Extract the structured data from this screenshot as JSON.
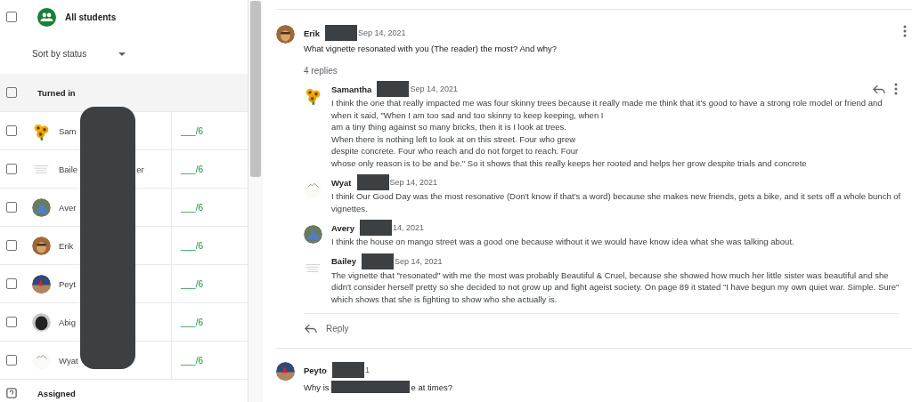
{
  "students_panel": {
    "select_all_checked": false,
    "title": "All students",
    "sort": {
      "label": "Sort by status"
    },
    "group": {
      "label": "Turned in",
      "checked": false
    },
    "students": [
      {
        "name_parts": [
          "Sam"
        ],
        "grade": "___/6",
        "checked": false,
        "kind": "sunflower"
      },
      {
        "name_parts": [
          "Baile",
          "er"
        ],
        "grade": "___/6",
        "checked": false,
        "kind": "note"
      },
      {
        "name_parts": [
          "Aver"
        ],
        "grade": "___/6",
        "checked": false,
        "kind": "blue"
      },
      {
        "name_parts": [
          "Erik"
        ],
        "grade": "___/6",
        "checked": false,
        "kind": "monkey"
      },
      {
        "name_parts": [
          "Peyt"
        ],
        "grade": "___/6",
        "checked": false,
        "kind": "cone"
      },
      {
        "name_parts": [
          "Abig"
        ],
        "grade": "___/6",
        "checked": false,
        "kind": "dog"
      },
      {
        "name_parts": [
          "Wyat"
        ],
        "grade": "___/6",
        "checked": false,
        "kind": "sketch"
      }
    ],
    "next_group": {
      "label": "Assigned"
    }
  },
  "threads": [
    {
      "author": "Erik",
      "date": "Sep 14, 2021",
      "kind": "monkey",
      "body_parts": [
        "What vignette resonated with you (The reader) the most? And why?"
      ],
      "replies_count": "4 replies",
      "replies": [
        {
          "author": "Samantha",
          "date": "Sep 14, 2021",
          "kind": "sunflower",
          "actions": true,
          "lines": [
            "I think the one that really impacted me was four skinny trees because it really made me think that it's good to have a strong role model or friend and when it said, \"When I am too sad and too skinny to keep keeping, when I",
            "am a tiny thing against so many bricks, then it is I look at trees.",
            "When there is nothing left to look at on this street. Four who grew",
            "despite concrete. Four who reach and do not forget to reach. Four",
            "whose only reason is to be and be.\" So it shows that this really keeps her rooted and helps her grow despite trials and concrete"
          ]
        },
        {
          "author": "Wyat",
          "date": "Sep 14, 2021",
          "kind": "sketch",
          "actions": false,
          "lines": [
            "I think Our Good Day was the most resonative (Don't know if that's a word) because she makes new friends, gets a bike, and it sets off a whole bunch of vignettes."
          ]
        },
        {
          "author": "Avery",
          "date": "14, 2021",
          "kind": "blue",
          "actions": false,
          "lines": [
            "I think the house on mango street was a good one because without it we would have know idea what she was talking about."
          ]
        },
        {
          "author": "Bailey",
          "date": "Sep 14, 2021",
          "kind": "note",
          "actions": false,
          "lines": [
            "The vignette that \"resonated\" with me the most was probably Beautiful & Cruel, because she showed how much her little sister was beautiful and she didn't consider herself pretty so she decided to not grow up and fight ageist  society.  On page 89 it stated \"I have begun my own quiet war. Simple. Sure\" which shows that she is fighting to show who she actually is."
          ]
        }
      ],
      "reply_button": "Reply"
    },
    {
      "author": "Peyto",
      "date": "1",
      "kind": "cone",
      "body_parts": [
        "Why is",
        "e at times?"
      ]
    }
  ]
}
